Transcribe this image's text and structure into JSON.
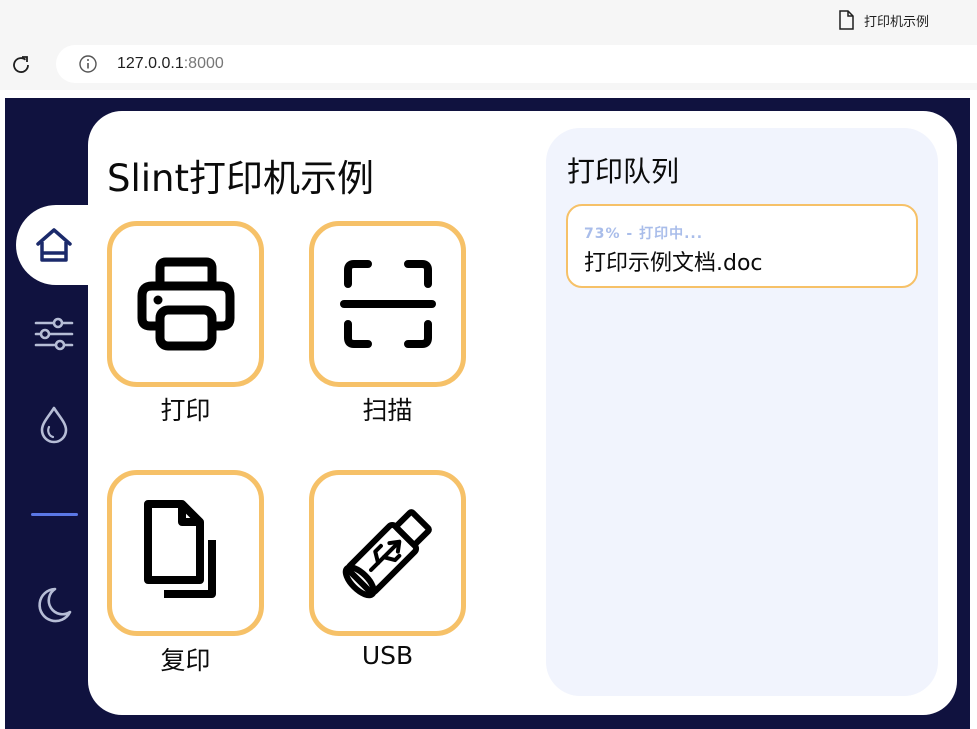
{
  "browser": {
    "tab_title": "打印机示例",
    "url_host": "127.0.0.1",
    "url_port": ":8000"
  },
  "app": {
    "title": "Slint打印机示例",
    "tiles": [
      {
        "label": "打印",
        "icon": "printer-icon"
      },
      {
        "label": "扫描",
        "icon": "scan-icon"
      },
      {
        "label": "复印",
        "icon": "copy-icon"
      },
      {
        "label": "USB",
        "icon": "usb-icon"
      }
    ],
    "sidebar": {
      "items": [
        {
          "icon": "home-icon",
          "active": true
        },
        {
          "icon": "settings-sliders-icon",
          "active": false
        },
        {
          "icon": "ink-drop-icon",
          "active": false
        },
        {
          "icon": "moon-icon",
          "active": false
        }
      ]
    },
    "queue": {
      "title": "打印队列",
      "jobs": [
        {
          "status": "73% - 打印中...",
          "name": "打印示例文档.doc",
          "progress": 0.73
        }
      ]
    }
  },
  "colors": {
    "background": "#10123f",
    "accent": "#f6c168",
    "panel": "#f1f4fd",
    "nav_active": "#1b2a6b",
    "divider": "#5b78e6"
  }
}
